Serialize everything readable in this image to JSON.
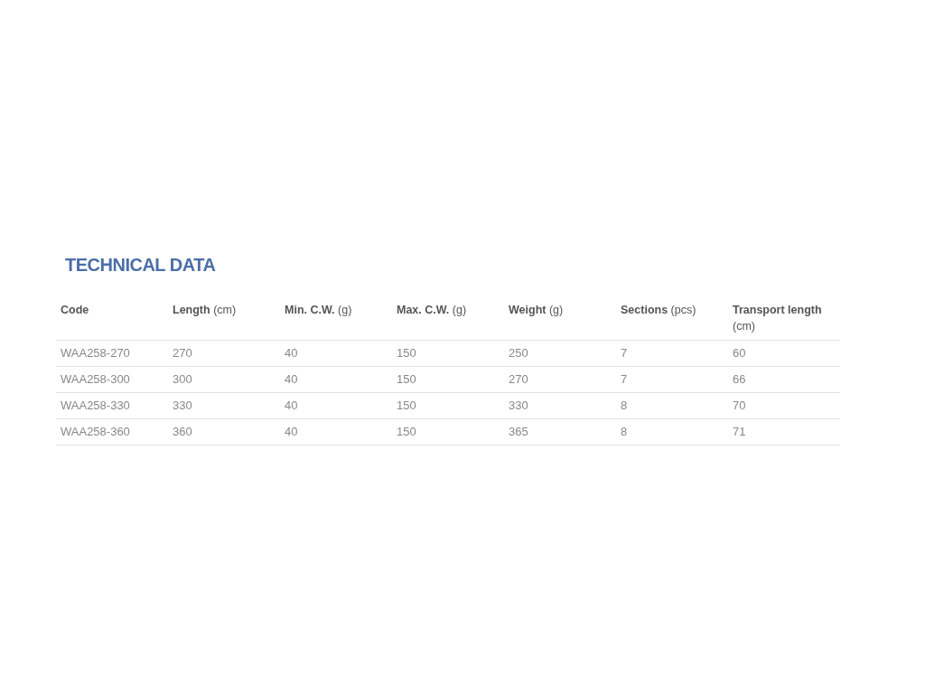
{
  "title": "TECHNICAL DATA",
  "table": {
    "columns": [
      "**Code**",
      "**Length** (cm)",
      "**Min. C.W.** (g)",
      "**Max. C.W.** (g)",
      "**Weight** (g)",
      "**Sections** (pcs)",
      "**Transport length** (cm)"
    ],
    "rows": [
      [
        "WAA258-270",
        "270",
        "40",
        "150",
        "250",
        "7",
        "60"
      ],
      [
        "WAA258-300",
        "300",
        "40",
        "150",
        "270",
        "7",
        "66"
      ],
      [
        "WAA258-330",
        "330",
        "40",
        "150",
        "330",
        "8",
        "70"
      ],
      [
        "WAA258-360",
        "360",
        "40",
        "150",
        "365",
        "8",
        "71"
      ]
    ]
  }
}
